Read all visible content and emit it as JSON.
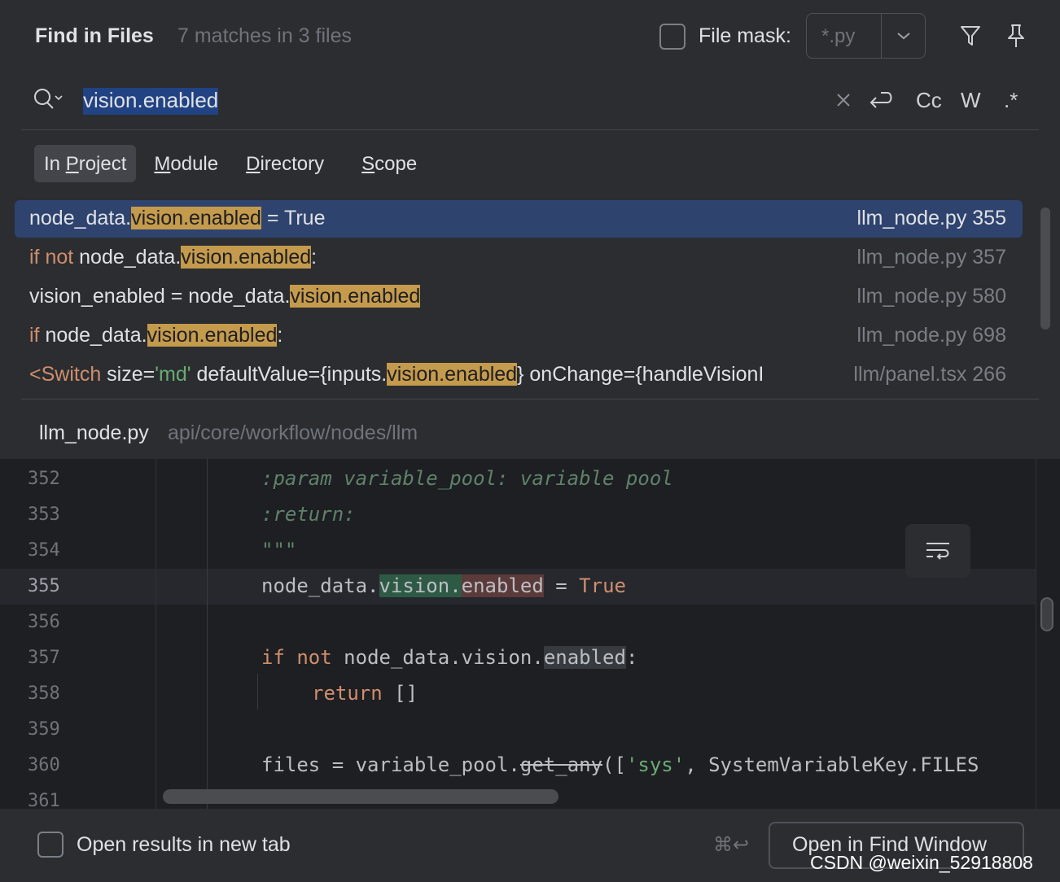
{
  "header": {
    "title": "Find in Files",
    "match_summary": "7 matches in 3 files",
    "file_mask_label": "File mask:",
    "file_mask_value": "*.py"
  },
  "search": {
    "query": "vision.enabled",
    "options": {
      "case_label": "Cc",
      "words_label": "W",
      "regex_label": ".*"
    }
  },
  "scope_tabs": [
    {
      "prefix": "In ",
      "mnemonic": "P",
      "rest": "roject",
      "active": true
    },
    {
      "prefix": "",
      "mnemonic": "M",
      "rest": "odule",
      "active": false
    },
    {
      "prefix": "",
      "mnemonic": "D",
      "rest": "irectory",
      "active": false
    },
    {
      "prefix": "",
      "mnemonic": "S",
      "rest": "cope",
      "active": false
    }
  ],
  "results": [
    {
      "pre": "node_data.",
      "match": "vision.enabled",
      "post": " = True",
      "file": "llm_node.py 355",
      "selected": true
    },
    {
      "kw": "if not",
      "pre": " node_data.",
      "match": "vision.enabled",
      "post": ":",
      "file": "llm_node.py 357",
      "selected": false
    },
    {
      "pre": "vision_enabled = node_data.",
      "match": "vision.enabled",
      "post": "",
      "file": "llm_node.py 580",
      "selected": false
    },
    {
      "kw": "if",
      "pre": " node_data.",
      "match": "vision.enabled",
      "post": ":",
      "file": "llm_node.py 698",
      "selected": false
    },
    {
      "tag": "<Switch",
      "attr1": " size=",
      "str1": "'md'",
      "attr2": " defaultValue=",
      "pre": "{inputs.",
      "match": "vision.enabled",
      "post": "} onChange={handleVisionI",
      "file": "llm/panel.tsx 266",
      "selected": false
    }
  ],
  "preview": {
    "file_name": "llm_node.py",
    "file_path": "api/core/workflow/nodes/llm",
    "line_numbers": [
      "352",
      "353",
      "354",
      "355",
      "356",
      "357",
      "358",
      "359",
      "360",
      "361"
    ],
    "lines": {
      "l352": ":param variable_pool: variable pool",
      "l353": ":return:",
      "l354": "\"\"\"",
      "l355_a": "node_data.",
      "l355_b": "vision.",
      "l355_c": "enabled",
      "l355_d": " = ",
      "l355_e": "True",
      "l357_kw1": "if",
      "l357_kw2": "not",
      "l357_a": " node_data.vision.",
      "l357_b": "enabled",
      "l357_c": ":",
      "l358_kw": "return",
      "l358_rest": " []",
      "l360_a": "files = variable_pool.",
      "l360_b": "get_any",
      "l360_c": "([",
      "l360_d": "'sys'",
      "l360_e": ", SystemVariableKey.FILES"
    }
  },
  "footer": {
    "open_new_tab_label": "Open results in new tab",
    "shortcut": "⌘↩",
    "open_button_label": "Open in Find Window"
  },
  "watermark": "CSDN @weixin_52918808",
  "colors": {
    "background": "#2b2d30",
    "editor_bg": "#1e1f22",
    "selection": "#2e436e",
    "match_highlight": "#c49a4c",
    "keyword": "#cf8e6d",
    "string": "#6aab73",
    "docstring": "#5f826b"
  }
}
